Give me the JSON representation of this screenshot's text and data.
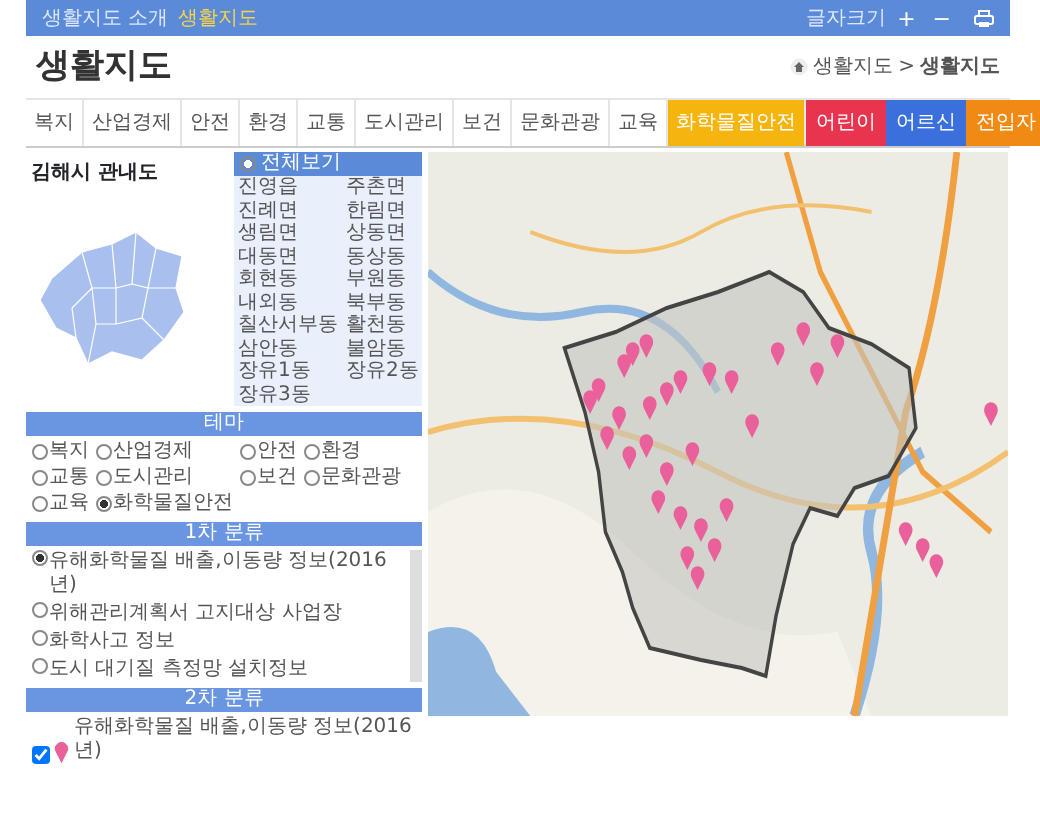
{
  "top_bar": {
    "links": [
      {
        "label": "생활지도 소개",
        "selected": false
      },
      {
        "label": "생활지도",
        "selected": true
      }
    ],
    "font_size_label": "글자크기",
    "font_buttons": [
      "+",
      "−"
    ]
  },
  "page_title": "생활지도",
  "breadcrumb": {
    "items": [
      "생활지도",
      "생활지도"
    ],
    "separator": ">"
  },
  "tabs": [
    {
      "label": "복지",
      "selected": false
    },
    {
      "label": "산업경제",
      "selected": false
    },
    {
      "label": "안전",
      "selected": false
    },
    {
      "label": "환경",
      "selected": false
    },
    {
      "label": "교통",
      "selected": false
    },
    {
      "label": "도시관리",
      "selected": false
    },
    {
      "label": "보건",
      "selected": false
    },
    {
      "label": "문화관광",
      "selected": false
    },
    {
      "label": "교육",
      "selected": false
    },
    {
      "label": "화학물질안전",
      "selected": true
    }
  ],
  "target_tabs": [
    {
      "label": "어린이",
      "color": "#e8344e"
    },
    {
      "label": "어르신",
      "color": "#3b6fdc"
    },
    {
      "label": "전입자",
      "color": "#f08a12"
    }
  ],
  "district_panel": {
    "title": "김해시 관내도",
    "all_option": {
      "label": "전체보기",
      "selected": true
    },
    "districts": [
      {
        "label": "진영읍",
        "selected": false
      },
      {
        "label": "주촌면",
        "selected": false
      },
      {
        "label": "진례면",
        "selected": false
      },
      {
        "label": "한림면",
        "selected": false
      },
      {
        "label": "생림면",
        "selected": false
      },
      {
        "label": "상동면",
        "selected": false
      },
      {
        "label": "대동면",
        "selected": false
      },
      {
        "label": "동상동",
        "selected": false
      },
      {
        "label": "회현동",
        "selected": false
      },
      {
        "label": "부원동",
        "selected": false
      },
      {
        "label": "내외동",
        "selected": false
      },
      {
        "label": "북부동",
        "selected": false
      },
      {
        "label": "칠산서부동",
        "selected": false
      },
      {
        "label": "활천동",
        "selected": false
      },
      {
        "label": "삼안동",
        "selected": false
      },
      {
        "label": "불암동",
        "selected": false
      },
      {
        "label": "장유1동",
        "selected": false
      },
      {
        "label": "장유2동",
        "selected": false
      },
      {
        "label": "장유3동",
        "selected": false
      }
    ]
  },
  "theme_section": {
    "title": "테마",
    "options": [
      {
        "label": "복지",
        "selected": false
      },
      {
        "label": "산업경제",
        "selected": false
      },
      {
        "label": "안전",
        "selected": false
      },
      {
        "label": "환경",
        "selected": false
      },
      {
        "label": "교통",
        "selected": false
      },
      {
        "label": "도시관리",
        "selected": false
      },
      {
        "label": "보건",
        "selected": false
      },
      {
        "label": "문화관광",
        "selected": false
      },
      {
        "label": "교육",
        "selected": false
      },
      {
        "label": "화학물질안전",
        "selected": true
      }
    ]
  },
  "category1": {
    "title": "1차 분류",
    "options": [
      {
        "label": "유해화학물질 배출,이동량 정보(2016년)",
        "selected": true
      },
      {
        "label": "위해관리계획서 고지대상 사업장",
        "selected": false
      },
      {
        "label": "화학사고 정보",
        "selected": false
      },
      {
        "label": "도시 대기질 측정망 설치정보",
        "selected": false
      }
    ]
  },
  "category2": {
    "title": "2차 분류",
    "items": [
      {
        "label": "유해화학물질 배출,이동량 정보(2016년)",
        "checked": true
      }
    ]
  }
}
